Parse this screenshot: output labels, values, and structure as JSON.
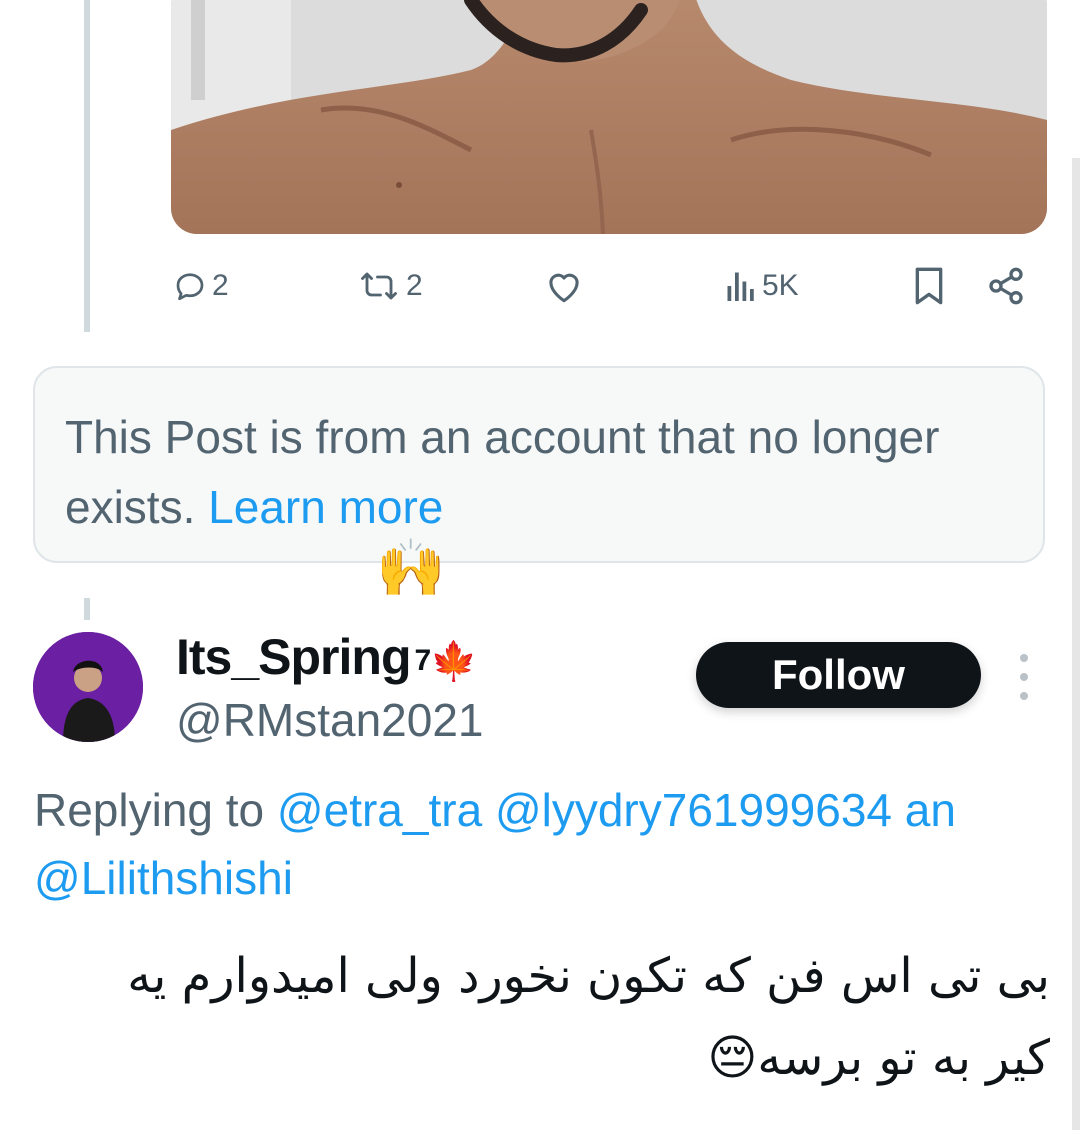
{
  "previous_post": {
    "actions": {
      "reply_count": "2",
      "repost_count": "2",
      "views": "5K"
    }
  },
  "notice": {
    "text": "This Post is from an account that no longer exists.",
    "link": "Learn more"
  },
  "emoji_hands": "🙌",
  "reply": {
    "display_name": "Its_Spring",
    "name_superscript": "7",
    "name_emoji": "🍁",
    "handle": "@RMstan2021",
    "follow_label": "Follow",
    "replying_prefix": "Replying to",
    "mentions": [
      "@etra_tra",
      "@lyydry761999634",
      "an"
    ],
    "mention_line2": "@Lilithshishi",
    "body_line1": "بی تی اس فن که تکون نخورد ولی امیدوارم یه",
    "body_line2": "کیر به تو برسه",
    "body_emoji": "😔"
  },
  "colors": {
    "accent": "#1d9bf0",
    "muted": "#536471",
    "text": "#0f1419",
    "follow_bg": "#0f1419"
  }
}
